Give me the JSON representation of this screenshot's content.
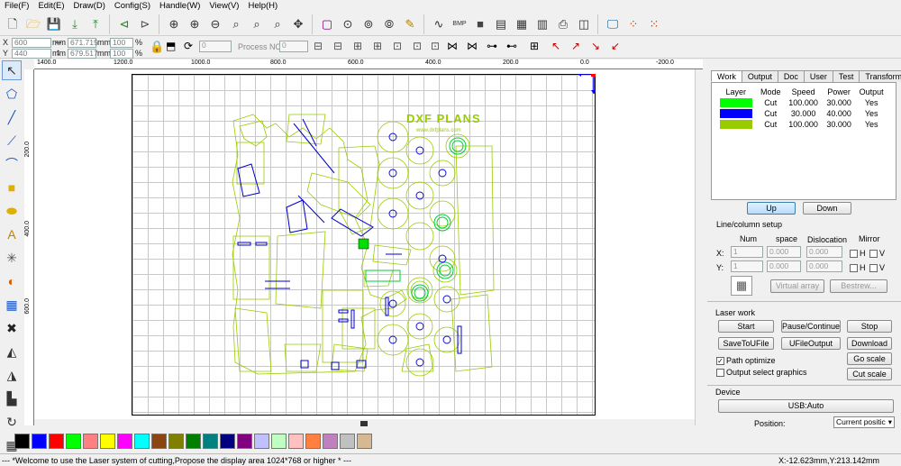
{
  "menu": {
    "items": [
      "File(F)",
      "Edit(E)",
      "Draw(D)",
      "Config(S)",
      "Handle(W)",
      "View(V)",
      "Help(H)"
    ]
  },
  "pos": {
    "x_label": "X",
    "y_label": "Y",
    "x_value": "600",
    "y_value": "440",
    "unit1": "mm",
    "unit2": "mm",
    "w_value": "671.715",
    "h_value": "679.517",
    "pct1": "100",
    "pct2": "100",
    "pct_unit": "%"
  },
  "process": {
    "value": "0",
    "label": "Process NO:",
    "no_value": "0"
  },
  "ruler": {
    "top": [
      "1400.0",
      "1200.0",
      "1000.0",
      "800.0",
      "600.0",
      "400.0",
      "200.0",
      "0.0",
      "-200.0"
    ],
    "left": [
      "200.0",
      "400.0",
      "600.0"
    ]
  },
  "palette": [
    "#000000",
    "#0000ff",
    "#ff0000",
    "#00ff00",
    "#ff8080",
    "#ffff00",
    "#ff00ff",
    "#00ffff",
    "#8b4513",
    "#808000",
    "#008000",
    "#008080",
    "#000080",
    "#800080",
    "#c0c0ff",
    "#c0ffc0",
    "#ffc0c0",
    "#ff8040",
    "#c080c0",
    "#c0c0c0",
    "#d8b890"
  ],
  "panel": {
    "tabs": [
      "Work",
      "Output",
      "Doc",
      "User",
      "Test",
      "Transform"
    ],
    "active_tab": "Work",
    "layer_headers": [
      "Layer",
      "Mode",
      "Speed",
      "Power",
      "Output"
    ],
    "layers": [
      {
        "color": "#00ff00",
        "mode": "Cut",
        "speed": "100.000",
        "power": "30.000",
        "output": "Yes"
      },
      {
        "color": "#0000ff",
        "mode": "Cut",
        "speed": "30.000",
        "power": "40.000",
        "output": "Yes"
      },
      {
        "color": "#99cc00",
        "mode": "Cut",
        "speed": "100.000",
        "power": "30.000",
        "output": "Yes"
      }
    ],
    "up": "Up",
    "down": "Down",
    "line_setup": "Line/column setup",
    "col_num": "Num",
    "col_space": "space",
    "col_disloc": "Dislocation",
    "col_mirror": "Mirror",
    "x_lbl": "X:",
    "y_lbl": "Y:",
    "x_num": "1",
    "x_space": "0.000",
    "x_disloc": "0.000",
    "y_num": "1",
    "y_space": "0.000",
    "y_disloc": "0.000",
    "h": "H",
    "v": "V",
    "virtual_array": "Virtual array",
    "bestrew": "Bestrew...",
    "laser_work": "Laser work",
    "start": "Start",
    "pause": "Pause/Continue",
    "stop": "Stop",
    "save_file": "SaveToUFile",
    "ufile_output": "UFileOutput",
    "download": "Download",
    "path_optimize": "Path optimize",
    "output_select": "Output select graphics",
    "go_scale": "Go scale",
    "cut_scale": "Cut scale",
    "device": "Device",
    "usb": "USB:Auto",
    "position_lbl": "Position:",
    "position_val": "Current positic"
  },
  "status": {
    "message": "--- *Welcome to use the Laser system of cutting,Propose the display area 1024*768 or higher * ---",
    "coords": "X:-12.623mm,Y:213.142mm"
  },
  "logo": {
    "text": "DXF PLANS",
    "url": "www.dxfplans.com"
  }
}
